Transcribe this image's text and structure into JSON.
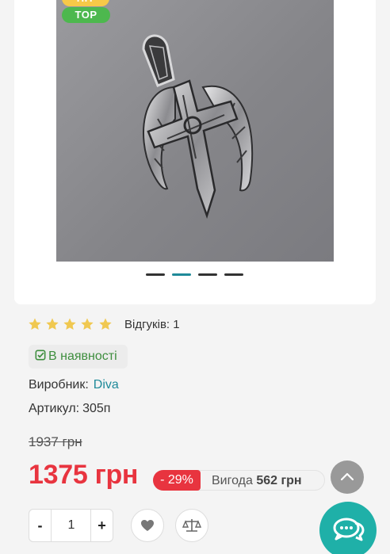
{
  "badges": {
    "hit": "HIT",
    "top": "TOP"
  },
  "product_image": {
    "alt": "Срібна підвіска хрест з крилами",
    "slides": 4,
    "active_slide": 2
  },
  "rating": {
    "stars": 5,
    "max": 5,
    "reviews_label": "Відгуків: 1"
  },
  "stock": {
    "label": "В наявності"
  },
  "manufacturer": {
    "label": "Виробник:",
    "value": "Diva"
  },
  "sku": {
    "label": "Артикул:",
    "value": "305п"
  },
  "price": {
    "old": "1937 грн",
    "current": "1375 грн",
    "discount_pct": "- 29%",
    "savings_label": "Вигода",
    "savings_value": "562 грн"
  },
  "quantity": {
    "minus": "-",
    "value": "1",
    "plus": "+"
  },
  "icons": {
    "wishlist": "heart-icon",
    "compare": "scales-icon",
    "scroll_top": "chevron-up-icon",
    "chat": "chat-bubbles-icon",
    "in_stock": "check-square-icon"
  },
  "colors": {
    "accent": "#1f8a99",
    "price": "#e8343f",
    "stock": "#3e8e3e",
    "chat": "#1fb0a8",
    "star": "#f0c850"
  }
}
